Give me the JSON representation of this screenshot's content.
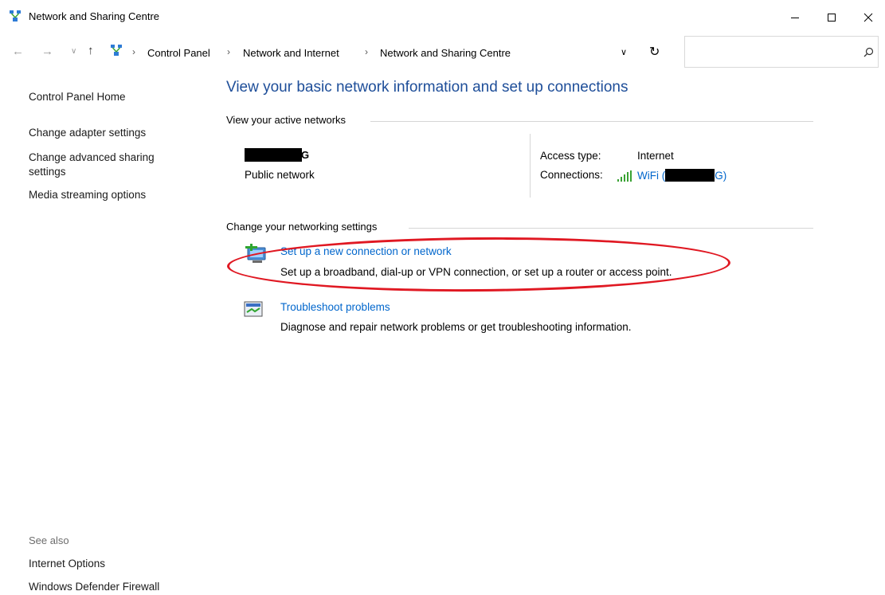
{
  "window": {
    "title": "Network and Sharing Centre"
  },
  "address_bar": {
    "crumbs": [
      "Control Panel",
      "Network and Internet",
      "Network and Sharing Centre"
    ],
    "search_placeholder": ""
  },
  "left_pane": {
    "home": "Control Panel Home",
    "links": [
      "Change adapter settings",
      "Change advanced sharing settings",
      "Media streaming options"
    ],
    "see_also_label": "See also",
    "see_also": [
      "Internet Options",
      "Windows Defender Firewall"
    ]
  },
  "main": {
    "heading": "View your basic network information and set up connections",
    "active_networks_label": "View your active networks",
    "network": {
      "name_suffix": "G",
      "type": "Public network",
      "access_type_label": "Access type:",
      "access_type_value": "Internet",
      "connections_label": "Connections:",
      "wifi_prefix": "WiFi (",
      "wifi_suffix": "G)"
    },
    "change_settings_label": "Change your networking settings",
    "tasks": [
      {
        "title": "Set up a new connection or network",
        "description": "Set up a broadband, dial-up or VPN connection, or set up a router or access point."
      },
      {
        "title": "Troubleshoot problems",
        "description": "Diagnose and repair network problems or get troubleshooting information."
      }
    ]
  },
  "colors": {
    "link": "#0066cc",
    "heading": "#1e4e99",
    "highlight": "#e01822"
  },
  "icons": {
    "app": "network-centre-icon",
    "new_connection": "new-connection-icon",
    "troubleshoot": "troubleshoot-icon",
    "signal": "wifi-signal-icon"
  }
}
